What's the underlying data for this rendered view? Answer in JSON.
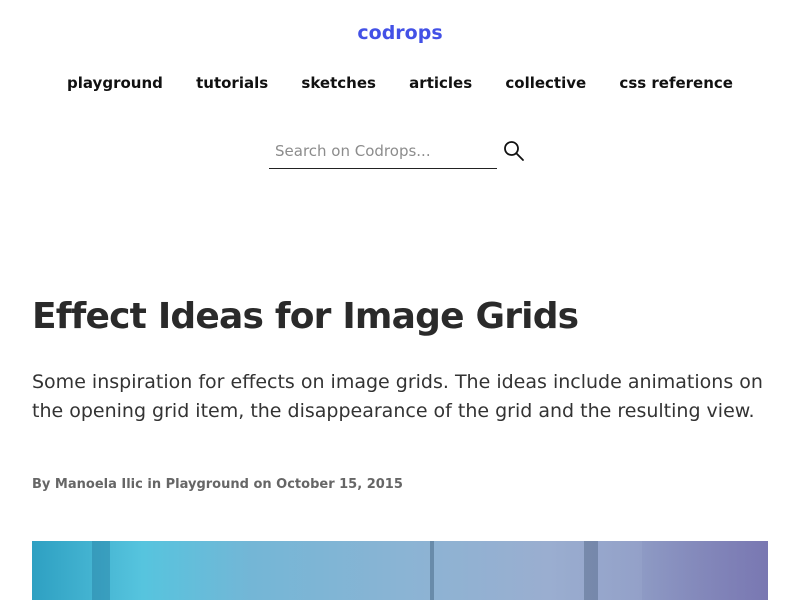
{
  "header": {
    "logo": "codrops",
    "nav": [
      "playground",
      "tutorials",
      "sketches",
      "articles",
      "collective",
      "css reference"
    ],
    "search": {
      "placeholder": "Search on Codrops...",
      "value": "",
      "icon": "search-icon"
    }
  },
  "article": {
    "title": "Effect Ideas for Image Grids",
    "lede": "Some inspiration for effects on image grids. The ideas include animations on the opening grid item, the disappearance of the grid and the resulting view.",
    "meta": {
      "by": "By",
      "author": "Manoela Ilic",
      "in": "in",
      "category": "Playground",
      "on": "on",
      "date": "October 15, 2015"
    }
  },
  "colors": {
    "brand": "#4351e6",
    "text": "#2a2a2a",
    "meta": "#666666"
  }
}
